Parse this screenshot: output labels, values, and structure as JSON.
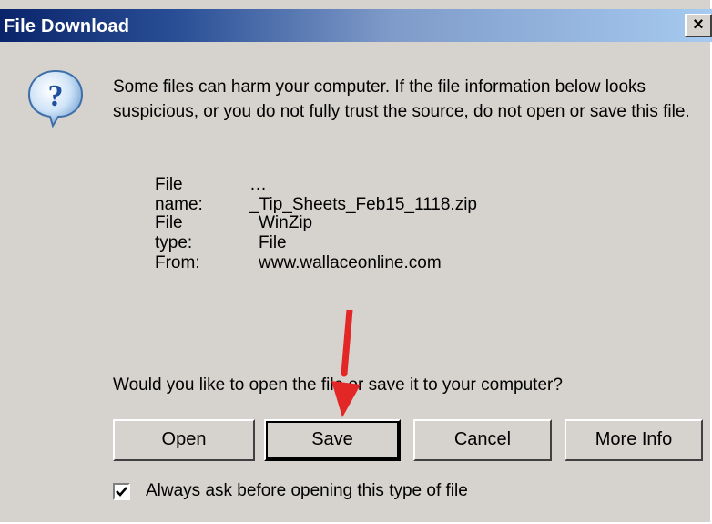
{
  "dialog": {
    "title": "File Download",
    "close_label": "×",
    "message": "Some files can harm your computer. If the file information below looks suspicious, or you do not fully trust the source, do not open or save this file.",
    "icon": "question-icon"
  },
  "file_info": {
    "name_label": "File name:",
    "name_value": "…_Tip_Sheets_Feb15_1118.zip",
    "type_label": "File type:",
    "type_value": "WinZip File",
    "from_label": "From:",
    "from_value": "www.wallaceonline.com"
  },
  "question": "Would you like to open the file or save it to your computer?",
  "buttons": {
    "open": "Open",
    "save": "Save",
    "cancel": "Cancel",
    "more_info": "More Info"
  },
  "checkbox": {
    "label": "Always ask before opening this type of file",
    "checked": true
  },
  "colors": {
    "dialog_bg": "#d6d3ce",
    "title_start": "#0a246a",
    "title_end": "#a6caf0",
    "arrow": "#e32626"
  }
}
